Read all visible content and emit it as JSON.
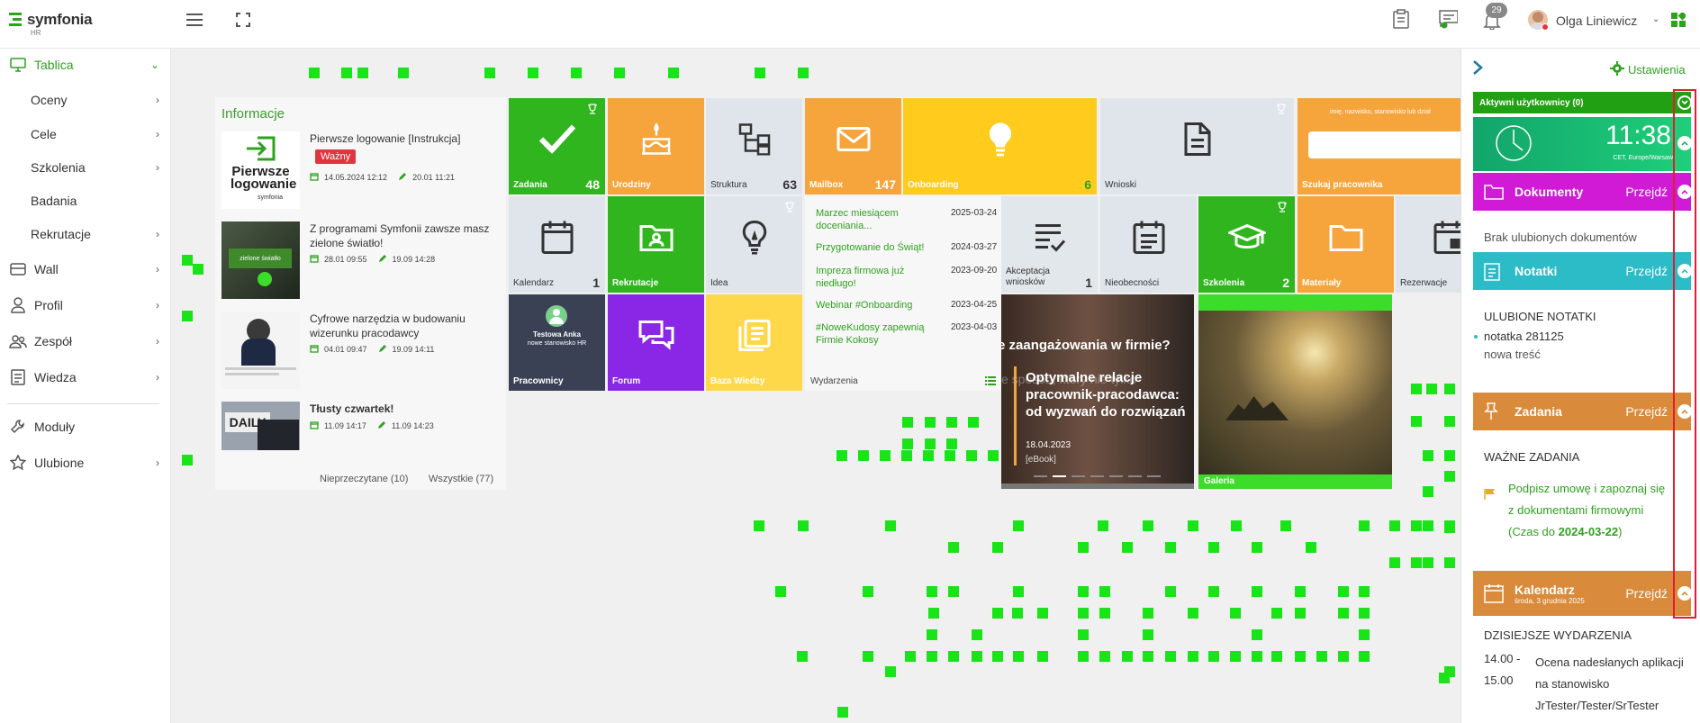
{
  "app": {
    "name": "symfonia",
    "subtitle": "HR",
    "accent": "#2fa11f"
  },
  "header": {
    "notif_count": "29",
    "user_name": "Olga Liniewicz"
  },
  "sidebar": {
    "items": [
      {
        "label": "Tablica",
        "icon": "monitor-icon",
        "active": true
      },
      {
        "label": "Oceny"
      },
      {
        "label": "Cele"
      },
      {
        "label": "Szkolenia"
      },
      {
        "label": "Badania"
      },
      {
        "label": "Rekrutacje"
      },
      {
        "label": "Wall",
        "icon": "wall-icon"
      },
      {
        "label": "Profil",
        "icon": "profile-icon"
      },
      {
        "label": "Zespół",
        "icon": "team-icon"
      },
      {
        "label": "Wiedza",
        "icon": "knowledge-icon"
      },
      {
        "label": "Moduły",
        "icon": "wrench-icon"
      },
      {
        "label": "Ulubione",
        "icon": "star-icon"
      }
    ]
  },
  "info": {
    "title": "Informacje",
    "items": [
      {
        "title": "Pierwsze logowanie [Instrukcja]",
        "badge": "Ważny",
        "date1": "14.05.2024 12:12",
        "date2": "20.01 11:21",
        "thumb_text": "Pierwsze logowanie",
        "thumb_brand": "symfonia"
      },
      {
        "title": "Z programami Symfonii zawsze masz zielone światło!",
        "date1": "28.01 09:55",
        "date2": "19.09 14:28",
        "thumb_text": "zielone światło"
      },
      {
        "title": "Cyfrowe narzędzia w budowaniu wizerunku pracodawcy",
        "date1": "04.01 09:47",
        "date2": "19.09 14:11"
      },
      {
        "title": "Tłusty czwartek!",
        "date1": "11.09 14:17",
        "date2": "11.09 14:23",
        "thumb_text": "DAILY"
      }
    ],
    "unread": "Nieprzeczytane (10)",
    "all": "Wszystkie (77)"
  },
  "tiles": [
    {
      "label": "Zadania",
      "count": "48",
      "icon": "check-icon"
    },
    {
      "label": "Urodziny",
      "icon": "cake-icon"
    },
    {
      "label": "Struktura",
      "count": "63",
      "icon": "structure-icon"
    },
    {
      "label": "Mailbox",
      "count": "147",
      "icon": "mail-icon"
    },
    {
      "label": "Onboarding",
      "count": "6",
      "icon": "bulb-icon"
    },
    {
      "label": "Wnioski",
      "icon": "document-icon"
    },
    {
      "label": "Szukaj pracownika",
      "search_hint": "imię, nazwisko, stanowisko lub dział"
    },
    {
      "label": "Kalendarz",
      "count": "1",
      "icon": "calendar-icon"
    },
    {
      "label": "Rekrutacje",
      "icon": "folder-user-icon"
    },
    {
      "label": "Idea",
      "icon": "idea-icon"
    },
    {
      "label": "Akceptacja wniosków",
      "count": "1",
      "icon": "list-check-icon"
    },
    {
      "label": "Nieobecności",
      "icon": "calendar-list-icon"
    },
    {
      "label": "Szkolenia",
      "count": "2",
      "icon": "graduation-icon"
    },
    {
      "label": "Materiały",
      "icon": "folder-icon"
    },
    {
      "label": "Rezerwacje",
      "icon": "calendar-icon"
    },
    {
      "label": "Pracownicy",
      "employee": "Testowa Anka",
      "employee_role": "nowe stanowisko HR"
    },
    {
      "label": "Forum",
      "icon": "chat-icon"
    },
    {
      "label": "Baza Wiedzy",
      "icon": "knowledge-icon"
    }
  ],
  "events": {
    "title": "Wydarzenia",
    "items": [
      {
        "name": "Marzec miesiącem doceniania...",
        "date": "2025-03-24"
      },
      {
        "name": "Przygotowanie do Świąt!",
        "date": "2024-03-27"
      },
      {
        "name": "Impreza firmowa już niedługo!",
        "date": "2023-09-20"
      },
      {
        "name": "Webinar #Onboarding",
        "date": "2023-04-25"
      },
      {
        "name": "#NoweKudosy zapewnią Firmie Kokosy",
        "date": "2023-04-03"
      }
    ]
  },
  "banner": {
    "headline": "e zaangażowania w firmie?",
    "ghost": "e sposób, który nie tylko",
    "title": "Optymalne relacje pracownik-pracodawca: od wyzwań do rozwiązań",
    "date": "18.04.2023",
    "tag": "[eBook]"
  },
  "gallery": {
    "label": "Galeria"
  },
  "rpanel": {
    "settings": "Ustawienia",
    "active_users": "Aktywni użytkownicy (0)",
    "clock": {
      "time": "11:38",
      "tz": "CET, Europe/Warsaw"
    },
    "go": "Przejdź",
    "documents": {
      "title": "Dokumenty",
      "empty": "Brak ulubionych dokumentów"
    },
    "notes": {
      "title": "Notatki",
      "section": "ULUBIONE NOTATKI",
      "note_title": "notatka 281125",
      "note_body": "nowa treść"
    },
    "tasks": {
      "title": "Zadania",
      "section": "WAŻNE ZADANIA",
      "task": "Podpisz umowę i zapoznaj się z dokumentami firmowymi",
      "deadline_prefix": "(Czas do ",
      "deadline": "2024-03-22",
      "deadline_suffix": ")"
    },
    "calendar": {
      "title": "Kalendarz",
      "date": "środa, 3 grudnia 2025",
      "section": "DZISIEJSZE WYDARZENIA",
      "time_from": "14.00 -",
      "time_to": "15.00",
      "event": "Ocena nadesłanych aplikacji na stanowisko JrTester/Tester/SrTester"
    }
  }
}
